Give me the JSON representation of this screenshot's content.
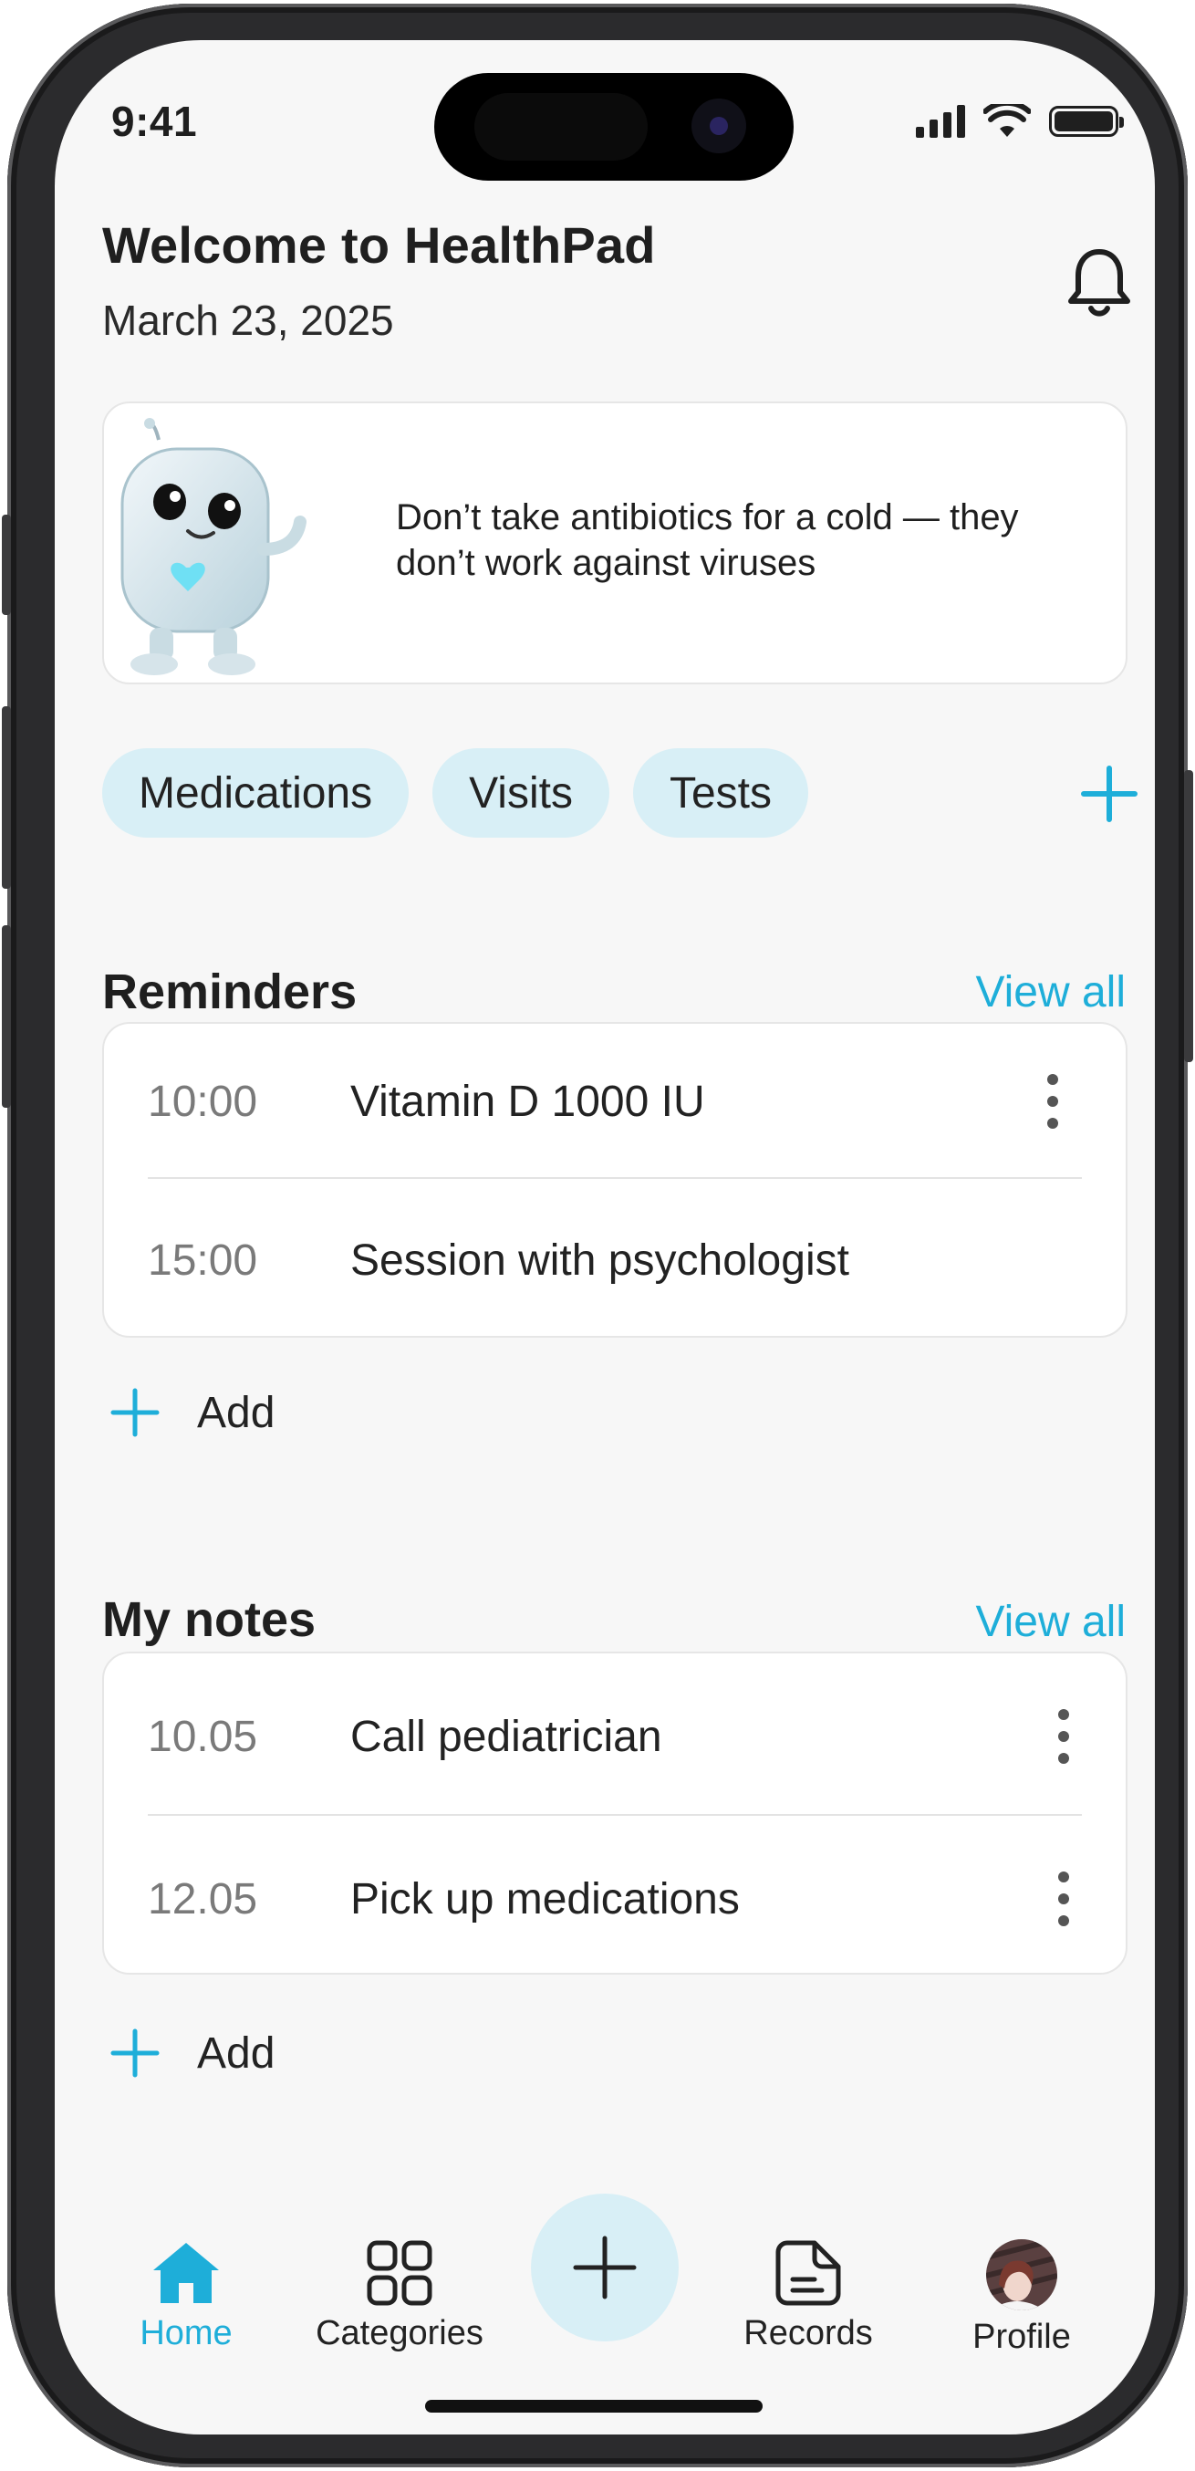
{
  "status_bar": {
    "time": "9:41"
  },
  "header": {
    "title": "Welcome to HealthPad",
    "date": "March 23, 2025"
  },
  "tip": {
    "text": "Don’t take antibiotics for a cold — they don’t work against viruses"
  },
  "chips": [
    "Medications",
    "Visits",
    "Tests"
  ],
  "reminders": {
    "title": "Reminders",
    "view_all": "View all",
    "items": [
      {
        "time": "10:00",
        "label": "Vitamin D  1000 IU"
      },
      {
        "time": "15:00",
        "label": "Session with psychologist"
      }
    ],
    "add_label": "Add"
  },
  "notes": {
    "title": "My notes",
    "view_all": "View all",
    "items": [
      {
        "time": "10.05",
        "label": "Call pediatrician"
      },
      {
        "time": "12.05",
        "label": "Pick up medications"
      }
    ],
    "add_label": "Add"
  },
  "tabbar": {
    "home": "Home",
    "categories": "Categories",
    "records": "Records",
    "profile": "Profile"
  },
  "colors": {
    "accent": "#1eaed9",
    "chip_bg": "#d8eff6",
    "background": "#f7f7f7"
  },
  "icons": [
    "bell-icon",
    "plus-icon",
    "more-vertical-icon",
    "home-icon",
    "grid-icon",
    "records-icon",
    "avatar"
  ]
}
